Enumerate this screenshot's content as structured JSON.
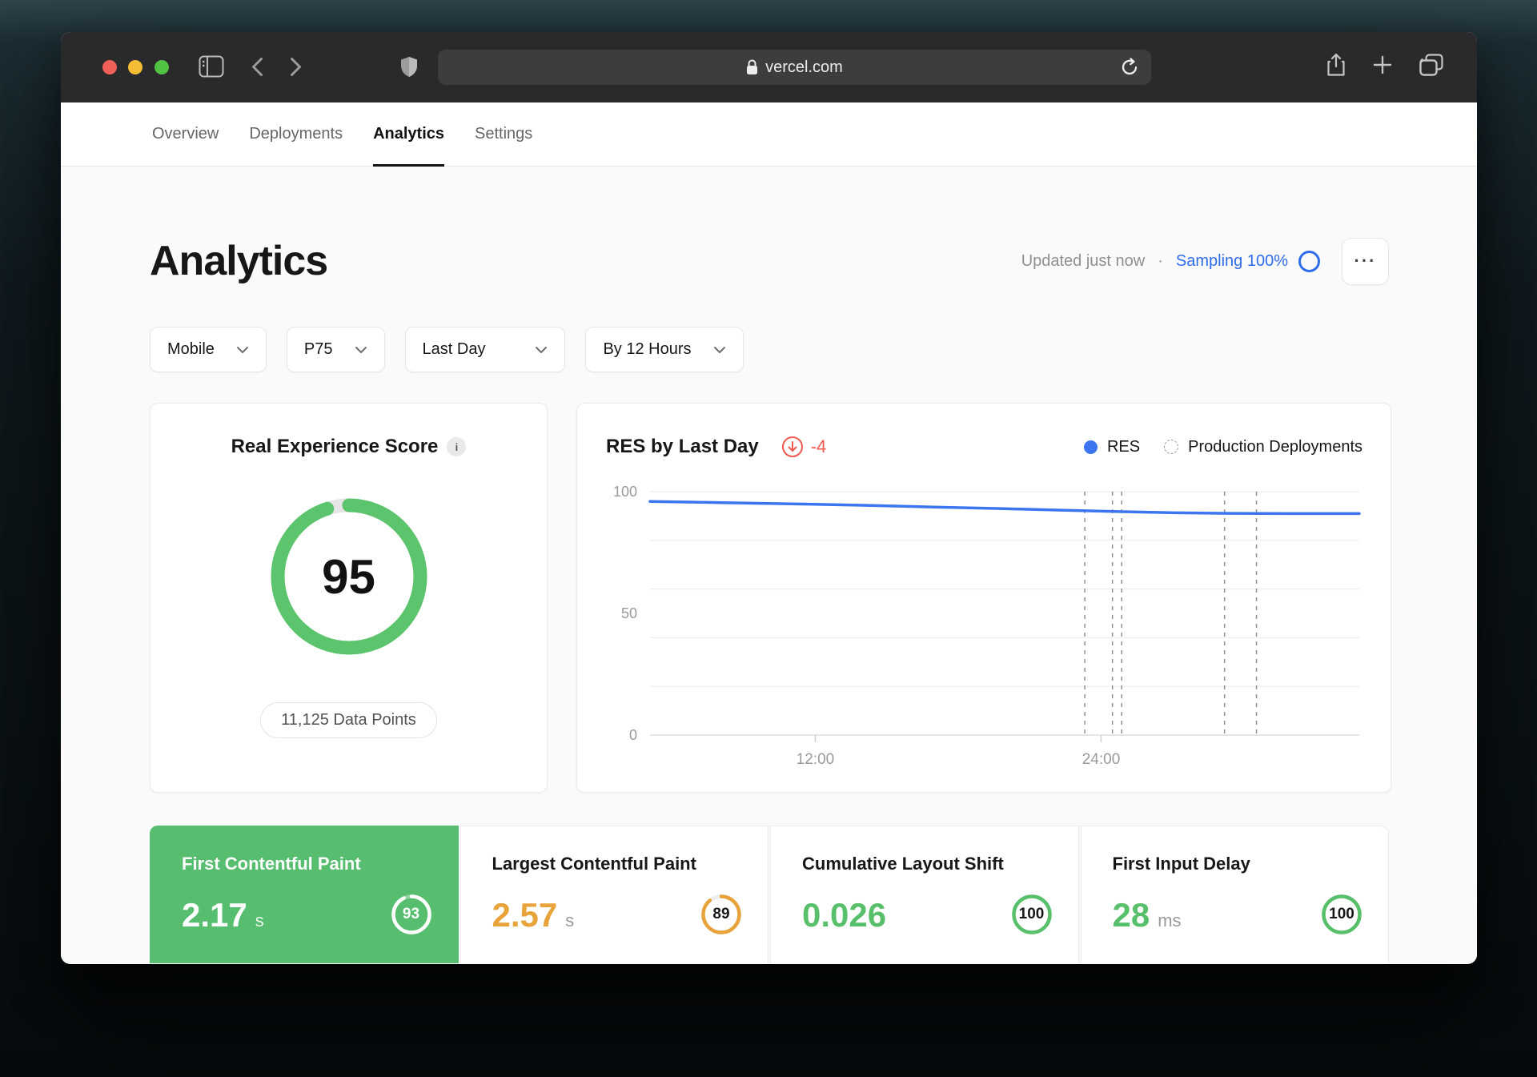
{
  "browser": {
    "url": "vercel.com"
  },
  "nav": {
    "tabs": [
      {
        "label": "Overview",
        "active": false
      },
      {
        "label": "Deployments",
        "active": false
      },
      {
        "label": "Analytics",
        "active": true
      },
      {
        "label": "Settings",
        "active": false
      }
    ]
  },
  "header": {
    "title": "Analytics",
    "updated": "Updated just now",
    "dot": "·",
    "sampling": "Sampling 100%",
    "menu": "···"
  },
  "filters": [
    {
      "label": "Mobile"
    },
    {
      "label": "P75"
    },
    {
      "label": "Last Day"
    },
    {
      "label": "By 12 Hours"
    }
  ],
  "res_card": {
    "title": "Real Experience Score",
    "info": "i",
    "score": 95,
    "data_points": "11,125 Data Points"
  },
  "chart_card": {
    "title": "RES by Last Day",
    "delta": "-4",
    "legend": [
      {
        "label": "RES"
      },
      {
        "label": "Production Deployments"
      }
    ]
  },
  "chart_data": {
    "type": "line",
    "title": "RES by Last Day",
    "ylim": [
      0,
      100
    ],
    "y_axis_labels": [
      100,
      50,
      0
    ],
    "gridline_values": [
      100,
      80,
      60,
      40,
      20,
      0
    ],
    "grid": true,
    "legend_position": "top-right",
    "x_ticks": [
      {
        "label": "12:00",
        "f": 0.233
      },
      {
        "label": "24:00",
        "f": 0.636
      }
    ],
    "series": [
      {
        "name": "RES",
        "points": [
          [
            0,
            96
          ],
          [
            0.1,
            95.5
          ],
          [
            0.2,
            95
          ],
          [
            0.3,
            94.4
          ],
          [
            0.4,
            93.7
          ],
          [
            0.5,
            93
          ],
          [
            0.58,
            92.4
          ],
          [
            0.66,
            91.8
          ],
          [
            0.74,
            91.3
          ],
          [
            0.82,
            91.1
          ],
          [
            0.9,
            91
          ],
          [
            1,
            91
          ]
        ]
      }
    ],
    "production_deployments_f": [
      0.613,
      0.652,
      0.665,
      0.81,
      0.855
    ]
  },
  "metrics": [
    {
      "title": "First Contentful Paint",
      "value": "2.17",
      "unit": "s",
      "score": 93,
      "selected": true,
      "color_key": "white"
    },
    {
      "title": "Largest Contentful Paint",
      "value": "2.57",
      "unit": "s",
      "score": 89,
      "selected": false,
      "color_key": "orange"
    },
    {
      "title": "Cumulative Layout Shift",
      "value": "0.026",
      "unit": "",
      "score": 100,
      "selected": false,
      "color_key": "green"
    },
    {
      "title": "First Input Delay",
      "value": "28",
      "unit": "ms",
      "score": 100,
      "selected": false,
      "color_key": "green"
    }
  ],
  "colors": {
    "green": "#58c06b",
    "green_card_bg": "#56be6e",
    "orange": "#e8a33b",
    "white": "#ffffff",
    "blue_line": "#3b76f0",
    "blue_link": "#2f6ceb",
    "red_delta": "#ee5a4f",
    "gauge_green": "#5bc46c",
    "track_gray": "#e5e5e5"
  }
}
